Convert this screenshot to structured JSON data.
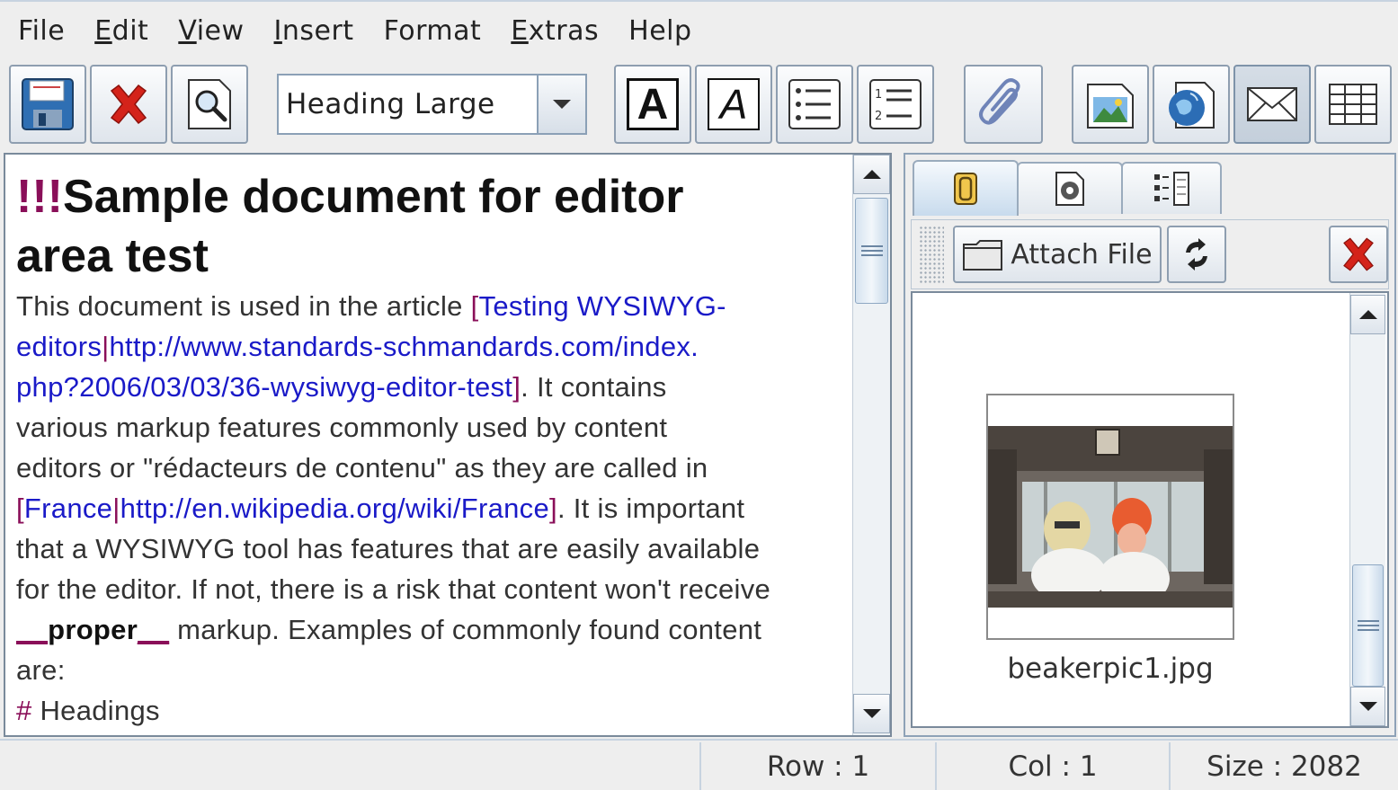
{
  "menubar": {
    "items": [
      {
        "pre": "",
        "mn": "",
        "post": "File"
      },
      {
        "pre": "",
        "mn": "E",
        "post": "dit"
      },
      {
        "pre": "",
        "mn": "V",
        "post": "iew"
      },
      {
        "pre": "",
        "mn": "I",
        "post": "nsert"
      },
      {
        "pre": "",
        "mn": "",
        "post": "Format"
      },
      {
        "pre": "",
        "mn": "E",
        "post": "xtras"
      },
      {
        "pre": "",
        "mn": "",
        "post": "Help"
      }
    ]
  },
  "toolbar": {
    "style_value": "Heading Large",
    "bold_glyph": "A",
    "italic_glyph": "A",
    "icons": [
      "save-icon",
      "cancel-icon",
      "preview-icon",
      "bold-icon",
      "italic-icon",
      "bullet-list-icon",
      "numbered-list-icon",
      "attachment-icon",
      "image-icon",
      "link-icon",
      "mail-icon",
      "table-icon"
    ]
  },
  "editor": {
    "heading_marker": "!!!",
    "heading_line1": "Sample document for editor",
    "heading_line2": "area test",
    "lines": [
      [
        {
          "t": "This document is used in the article ",
          "c": "n"
        },
        {
          "t": "[",
          "c": "mk"
        },
        {
          "t": "Testing WYSIWYG-",
          "c": "lnk"
        }
      ],
      [
        {
          "t": "editors",
          "c": "lnk"
        },
        {
          "t": "|",
          "c": "mk"
        },
        {
          "t": "http://www.standards-schmandards.com/index.",
          "c": "lnk"
        }
      ],
      [
        {
          "t": "php?2006/03/03/36-wysiwyg-editor-test",
          "c": "lnk"
        },
        {
          "t": "]",
          "c": "mk"
        },
        {
          "t": ". It contains",
          "c": "n"
        }
      ],
      [
        {
          "t": "various markup features commonly used by content",
          "c": "n"
        }
      ],
      [
        {
          "t": "editors or \"rédacteurs de contenu\" as they are called in",
          "c": "n"
        }
      ],
      [
        {
          "t": "[",
          "c": "mk"
        },
        {
          "t": "France",
          "c": "lnk"
        },
        {
          "t": "|",
          "c": "mk"
        },
        {
          "t": "http://en.wikipedia.org/wiki/France",
          "c": "lnk"
        },
        {
          "t": "]",
          "c": "mk"
        },
        {
          "t": ". It is important",
          "c": "n"
        }
      ],
      [
        {
          "t": "that a WYSIWYG tool has features that are easily available",
          "c": "n"
        }
      ],
      [
        {
          "t": "for the editor. If not, there is a risk that content won't receive",
          "c": "n"
        }
      ],
      [
        {
          "t": "__",
          "c": "ul"
        },
        {
          "t": "proper",
          "c": "bold"
        },
        {
          "t": "__",
          "c": "ul"
        },
        {
          "t": " markup. Examples of commonly found content",
          "c": "n"
        }
      ],
      [
        {
          "t": "are:",
          "c": "n"
        }
      ],
      [
        {
          "t": "#",
          "c": "mk"
        },
        {
          "t": " Headings",
          "c": "n"
        }
      ]
    ]
  },
  "right_panel": {
    "tabs": [
      "attachments-tab",
      "settings-tab",
      "outline-tab"
    ],
    "attach_label": "Attach File",
    "attachment_filename": "beakerpic1.jpg"
  },
  "statusbar": {
    "row": "Row : 1",
    "col": "Col : 1",
    "size": "Size : 2082"
  },
  "colors": {
    "markup": "#8a0f59",
    "link": "#1a1ac8",
    "delete_red": "#d4231a"
  }
}
